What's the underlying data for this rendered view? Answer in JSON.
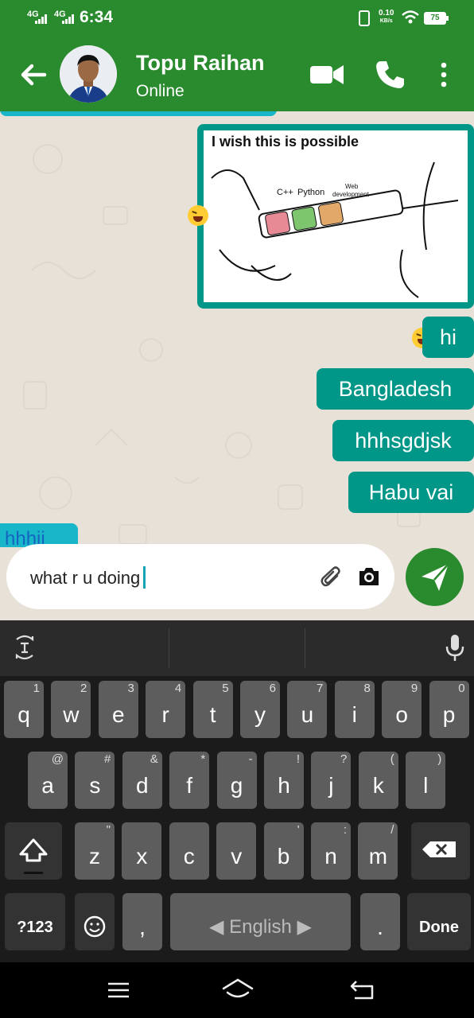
{
  "status_bar": {
    "network1": "4G",
    "network2": "4G",
    "time": "6:34",
    "speed": "0.10",
    "speed_unit": "KB/s",
    "battery": "75"
  },
  "header": {
    "contact_name": "Topu Raihan",
    "contact_status": "Online",
    "accent_color": "#2a8a2e"
  },
  "messages": {
    "image_caption": "I wish this is possible",
    "image_labels": [
      "C++",
      "Python",
      "Web",
      "development"
    ],
    "outgoing": [
      "hi",
      "Bangladesh",
      "hhhsgdjsk",
      "Habu vai"
    ],
    "incoming_partial": "hhhii"
  },
  "composer": {
    "text": "what r u doing"
  },
  "keyboard": {
    "row1": [
      {
        "k": "q",
        "h": "1"
      },
      {
        "k": "w",
        "h": "2"
      },
      {
        "k": "e",
        "h": "3"
      },
      {
        "k": "r",
        "h": "4"
      },
      {
        "k": "t",
        "h": "5"
      },
      {
        "k": "y",
        "h": "6"
      },
      {
        "k": "u",
        "h": "7"
      },
      {
        "k": "i",
        "h": "8"
      },
      {
        "k": "o",
        "h": "9"
      },
      {
        "k": "p",
        "h": "0"
      }
    ],
    "row2": [
      {
        "k": "a",
        "h": "@"
      },
      {
        "k": "s",
        "h": "#"
      },
      {
        "k": "d",
        "h": "&"
      },
      {
        "k": "f",
        "h": "*"
      },
      {
        "k": "g",
        "h": "-"
      },
      {
        "k": "h",
        "h": "!"
      },
      {
        "k": "j",
        "h": "?"
      },
      {
        "k": "k",
        "h": "("
      },
      {
        "k": "l",
        "h": ")"
      }
    ],
    "row3": [
      {
        "k": "z",
        "h": "\""
      },
      {
        "k": "x",
        "h": ""
      },
      {
        "k": "c",
        "h": ""
      },
      {
        "k": "v",
        "h": ""
      },
      {
        "k": "b",
        "h": "'"
      },
      {
        "k": "n",
        "h": ":"
      },
      {
        "k": "m",
        "h": "/"
      }
    ],
    "symbols_label": "?123",
    "comma": ",",
    "space_label": "English",
    "period": ".",
    "done_label": "Done"
  }
}
